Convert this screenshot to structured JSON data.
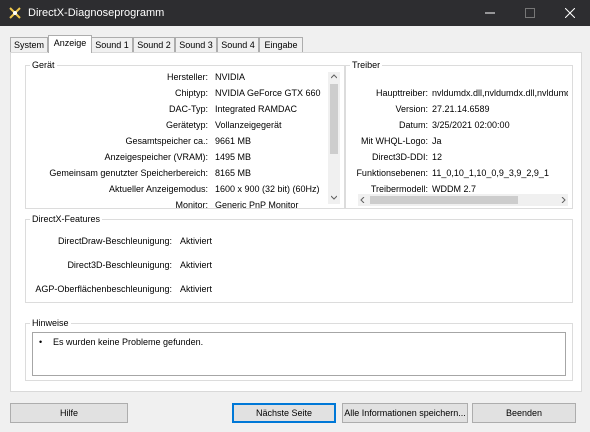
{
  "window": {
    "title": "DirectX-Diagnoseprogramm",
    "min_icon": "minimize-icon",
    "max_icon": "maximize-icon",
    "close_icon": "close-icon"
  },
  "tabs": [
    {
      "label": "System"
    },
    {
      "label": "Anzeige"
    },
    {
      "label": "Sound 1"
    },
    {
      "label": "Sound 2"
    },
    {
      "label": "Sound 3"
    },
    {
      "label": "Sound 4"
    },
    {
      "label": "Eingabe"
    }
  ],
  "device": {
    "title": "Gerät",
    "rows": [
      {
        "label": "Hersteller:",
        "value": "NVIDIA"
      },
      {
        "label": "Chiptyp:",
        "value": "NVIDIA GeForce GTX 660"
      },
      {
        "label": "DAC-Typ:",
        "value": "Integrated RAMDAC"
      },
      {
        "label": "Gerätetyp:",
        "value": "Vollanzeigegerät"
      },
      {
        "label": "Gesamtspeicher ca.:",
        "value": "9661 MB"
      },
      {
        "label": "Anzeigespeicher (VRAM):",
        "value": "1495 MB"
      },
      {
        "label": "Gemeinsam genutzter Speicherbereich:",
        "value": "8165 MB"
      },
      {
        "label": "Aktueller Anzeigemodus:",
        "value": "1600 x 900 (32 bit) (60Hz)"
      },
      {
        "label": "Monitor:",
        "value": "Generic PnP Monitor"
      }
    ]
  },
  "driver": {
    "title": "Treiber",
    "rows": [
      {
        "label": "Haupttreiber:",
        "value": "nvldumdx.dll,nvldumdx.dll,nvldumd"
      },
      {
        "label": "Version:",
        "value": "27.21.14.6589"
      },
      {
        "label": "Datum:",
        "value": "3/25/2021 02:00:00"
      },
      {
        "label": "Mit WHQL-Logo:",
        "value": "Ja"
      },
      {
        "label": "Direct3D-DDI:",
        "value": "12"
      },
      {
        "label": "Funktionsebenen:",
        "value": "11_0,10_1,10_0,9_3,9_2,9_1"
      },
      {
        "label": "Treibermodell:",
        "value": "WDDM 2.7"
      }
    ]
  },
  "features": {
    "title": "DirectX-Features",
    "rows": [
      {
        "label": "DirectDraw-Beschleunigung:",
        "value": "Aktiviert"
      },
      {
        "label": "Direct3D-Beschleunigung:",
        "value": "Aktiviert"
      },
      {
        "label": "AGP-Oberflächenbeschleunigung:",
        "value": "Aktiviert"
      }
    ]
  },
  "notes": {
    "title": "Hinweise",
    "items": [
      "Es wurden keine Probleme gefunden."
    ]
  },
  "buttons": {
    "help": "Hilfe",
    "next": "Nächste Seite",
    "save_all": "Alle Informationen speichern...",
    "exit": "Beenden"
  }
}
